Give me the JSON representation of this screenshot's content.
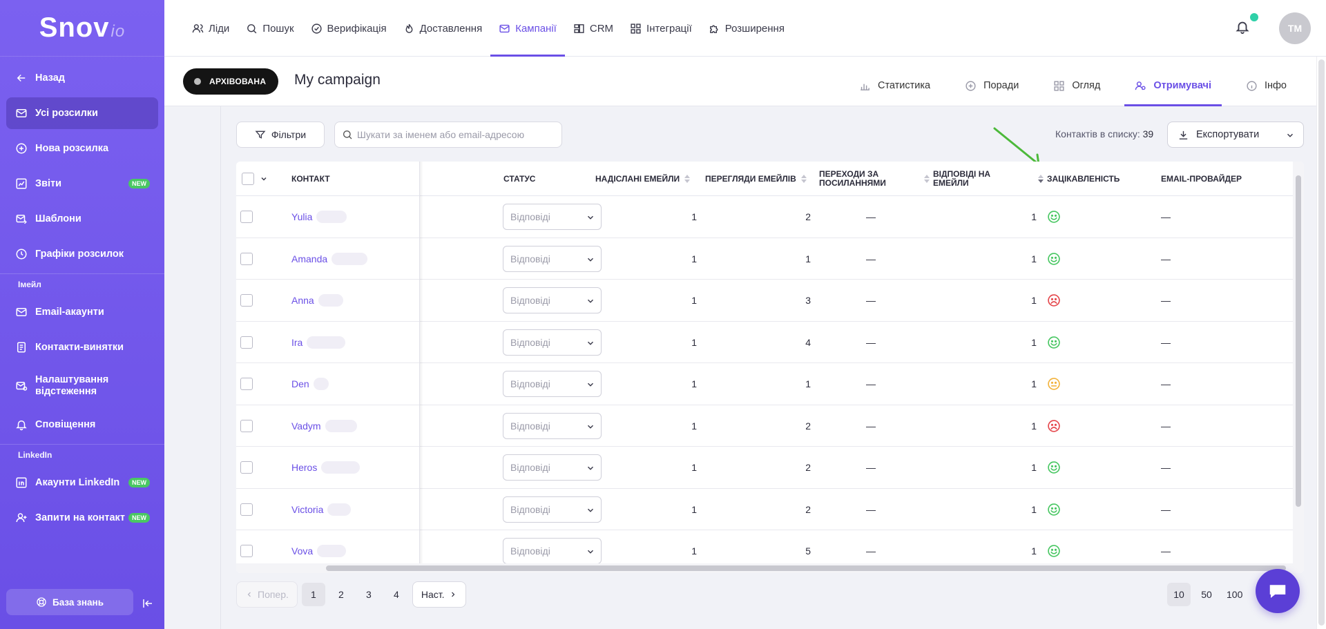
{
  "app": {
    "logo_main": "Snov",
    "logo_suffix": "io"
  },
  "sidebar": {
    "back": "Назад",
    "items": [
      {
        "label": "Усі розсилки"
      },
      {
        "label": "Нова розсилка"
      },
      {
        "label": "Звіти",
        "badge": "NEW"
      },
      {
        "label": "Шаблони"
      },
      {
        "label": "Графіки розсилок"
      }
    ],
    "section_email": "Імейл",
    "email_items": [
      {
        "label": "Email-акаунти"
      },
      {
        "label": "Контакти-винятки"
      },
      {
        "label": "Налаштування відстеження"
      },
      {
        "label": "Сповіщення"
      }
    ],
    "section_linkedin": "LinkedIn",
    "linkedin_items": [
      {
        "label": "Акаунти LinkedIn",
        "badge": "NEW"
      },
      {
        "label": "Запити на контакт",
        "badge": "NEW"
      }
    ],
    "knowledge_base": "База знань"
  },
  "topnav": {
    "items": [
      "Ліди",
      "Пошук",
      "Верифікація",
      "Доставлення",
      "Кампанії",
      "CRM",
      "Інтеграції",
      "Розширення"
    ],
    "avatar_initials": "TM"
  },
  "campaign": {
    "status_badge": "АРХІВОВАНА",
    "title": "My campaign",
    "tabs": [
      "Статистика",
      "Поради",
      "Огляд",
      "Отримувачі",
      "Інфо"
    ]
  },
  "toolbar": {
    "filters_label": "Фільтри",
    "search_placeholder": "Шукати за іменем або email-адресою",
    "contacts_label": "Контактів в списку:",
    "contacts_count": "39",
    "export_label": "Експортувати"
  },
  "table": {
    "headers": {
      "contact": "Контакт",
      "status": "Статус",
      "sent": "Надіслані емейли",
      "views": "Перегляди емейлів",
      "clicks_line1": "Переходи за",
      "clicks_line2": "посиланнями",
      "replies_line1": "Відповіді на",
      "replies_line2": "емейли",
      "interest": "Зацікавленість",
      "provider": "Email-провайдер"
    },
    "rows": [
      {
        "name": "Yulia",
        "status": "Відповіді",
        "sent": "1",
        "views": "2",
        "clicks": "—",
        "replies": "1",
        "interest": "positive",
        "provider": "—"
      },
      {
        "name": "Amanda",
        "status": "Відповіді",
        "sent": "1",
        "views": "1",
        "clicks": "—",
        "replies": "1",
        "interest": "positive",
        "provider": "—"
      },
      {
        "name": "Anna",
        "status": "Відповіді",
        "sent": "1",
        "views": "3",
        "clicks": "—",
        "replies": "1",
        "interest": "negative",
        "provider": "—"
      },
      {
        "name": "Ira",
        "status": "Відповіді",
        "sent": "1",
        "views": "4",
        "clicks": "—",
        "replies": "1",
        "interest": "positive",
        "provider": "—"
      },
      {
        "name": "Den",
        "status": "Відповіді",
        "sent": "1",
        "views": "1",
        "clicks": "—",
        "replies": "1",
        "interest": "neutral",
        "provider": "—"
      },
      {
        "name": "Vadym",
        "status": "Відповіді",
        "sent": "1",
        "views": "2",
        "clicks": "—",
        "replies": "1",
        "interest": "negative",
        "provider": "—"
      },
      {
        "name": "Heros",
        "status": "Відповіді",
        "sent": "1",
        "views": "2",
        "clicks": "—",
        "replies": "1",
        "interest": "positive",
        "provider": "—"
      },
      {
        "name": "Victoria",
        "status": "Відповіді",
        "sent": "1",
        "views": "2",
        "clicks": "—",
        "replies": "1",
        "interest": "positive",
        "provider": "—"
      },
      {
        "name": "Vova",
        "status": "Відповіді",
        "sent": "1",
        "views": "5",
        "clicks": "—",
        "replies": "1",
        "interest": "positive",
        "provider": "—"
      }
    ]
  },
  "pagination": {
    "prev": "Попер.",
    "pages": [
      "1",
      "2",
      "3",
      "4"
    ],
    "current": "1",
    "next": "Наст.",
    "per_page": [
      "10",
      "50",
      "100"
    ],
    "per_page_selected": "10"
  },
  "colors": {
    "accent": "#6a4fe6",
    "positive": "#49c763",
    "neutral": "#f2b33d",
    "negative": "#e5484d"
  }
}
